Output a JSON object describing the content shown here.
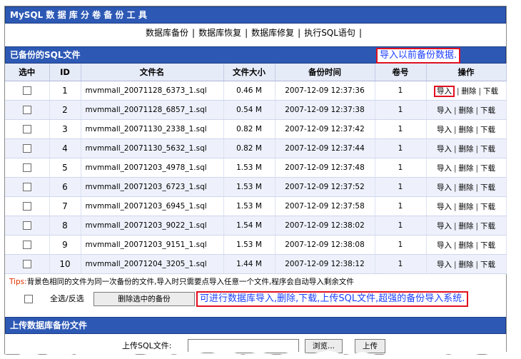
{
  "app": {
    "title": "MySQL 数 据 库 分 卷 备 份 工 具"
  },
  "nav": {
    "items": [
      "数据库备份",
      "数据库恢复",
      "数据库修复",
      "执行SQL语句"
    ]
  },
  "list_section": {
    "title": "已备份的SQL文件",
    "callout": "导入以前备份数据."
  },
  "table": {
    "headers": {
      "select": "选中",
      "id": "ID",
      "filename": "文件名",
      "size": "文件大小",
      "time": "备份时间",
      "volume": "卷号",
      "actions": "操作"
    },
    "action_labels": {
      "import": "导入",
      "delete": "删除",
      "download": "下载"
    },
    "rows": [
      {
        "id": "1",
        "file": "mvmmall_20071128_6373_1.sql",
        "size": "0.46 M",
        "time": "2007-12-09 12:37:36",
        "vol": "1"
      },
      {
        "id": "2",
        "file": "mvmmall_20071128_6857_1.sql",
        "size": "0.54 M",
        "time": "2007-12-09 12:37:38",
        "vol": "1"
      },
      {
        "id": "3",
        "file": "mvmmall_20071130_2338_1.sql",
        "size": "0.82 M",
        "time": "2007-12-09 12:37:42",
        "vol": "1"
      },
      {
        "id": "4",
        "file": "mvmmall_20071130_5632_1.sql",
        "size": "0.82 M",
        "time": "2007-12-09 12:37:44",
        "vol": "1"
      },
      {
        "id": "5",
        "file": "mvmmall_20071203_4978_1.sql",
        "size": "1.53 M",
        "time": "2007-12-09 12:37:48",
        "vol": "1"
      },
      {
        "id": "6",
        "file": "mvmmall_20071203_6723_1.sql",
        "size": "1.53 M",
        "time": "2007-12-09 12:37:52",
        "vol": "1"
      },
      {
        "id": "7",
        "file": "mvmmall_20071203_6945_1.sql",
        "size": "1.53 M",
        "time": "2007-12-09 12:37:58",
        "vol": "1"
      },
      {
        "id": "8",
        "file": "mvmmall_20071203_9022_1.sql",
        "size": "1.54 M",
        "time": "2007-12-09 12:38:02",
        "vol": "1"
      },
      {
        "id": "9",
        "file": "mvmmall_20071203_9151_1.sql",
        "size": "1.53 M",
        "time": "2007-12-09 12:38:08",
        "vol": "1"
      },
      {
        "id": "10",
        "file": "mvmmall_20071204_3205_1.sql",
        "size": "1.44 M",
        "time": "2007-12-09 12:38:12",
        "vol": "1"
      }
    ]
  },
  "tips": {
    "label": "Tips:",
    "text": "背景色相同的文件为同一次备份的文件,导入时只需要点导入任意一个文件,程序会自动导入剩余文件"
  },
  "batch": {
    "select_all": "全选/反选",
    "delete_button": "删除选中的备份",
    "callout": "可进行数据库导入,删除,下载,上传SQL文件,超强的备份导入系统."
  },
  "upload": {
    "title": "上传数据库备份文件",
    "label": "上传SQL文件:",
    "browse": "浏览...",
    "submit": "上传"
  },
  "colors": {
    "header_bar": "#2d59b5",
    "row_alt": "#eef1fb",
    "callout_text": "#1e40ff",
    "callout_border": "#e01020",
    "tips_label": "#e03000"
  }
}
